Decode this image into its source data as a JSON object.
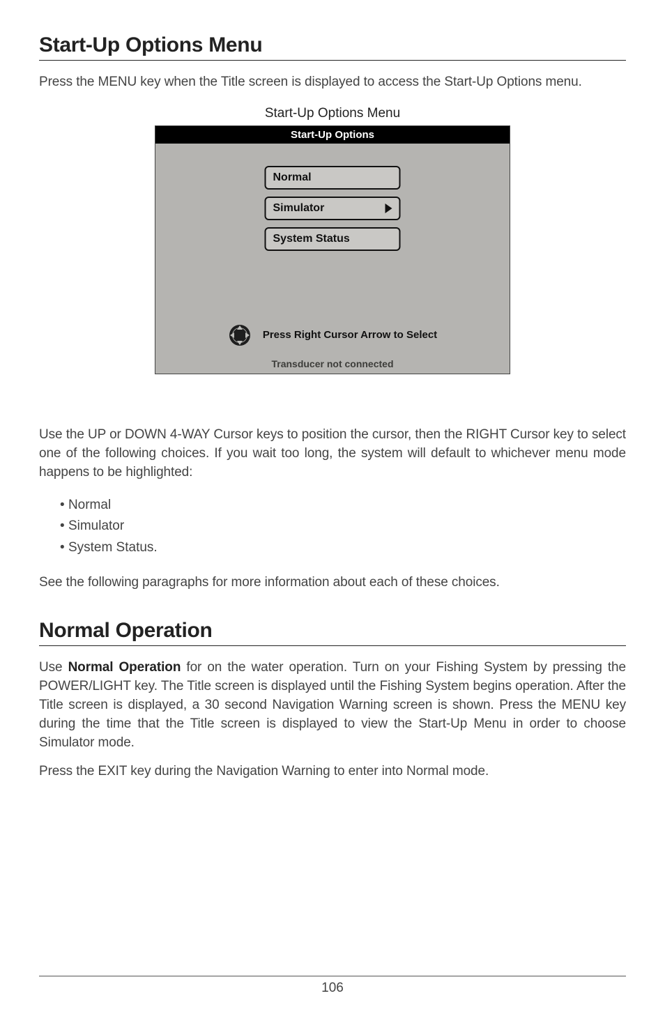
{
  "section1": {
    "title": "Start-Up Options Menu",
    "intro": "Press the MENU key when the Title screen is displayed to access the Start-Up Options menu.",
    "caption": "Start-Up Options Menu"
  },
  "shot": {
    "title": "Start-Up Options",
    "options": {
      "normal": "Normal",
      "simulator": "Simulator",
      "system_status": "System Status"
    },
    "hint": "Press Right Cursor Arrow to Select",
    "footer": "Transducer not connected",
    "cursor_icon": "four-way-cursor-icon"
  },
  "after": {
    "para": "Use the UP or DOWN 4-WAY Cursor keys to position the cursor, then the RIGHT Cursor key to select one of the following choices. If you wait too long, the system will default to whichever menu mode happens to be highlighted:",
    "bullets": {
      "b1": "Normal",
      "b2": "Simulator",
      "b3": "System Status."
    },
    "see": "See the following paragraphs for more information about each of these choices."
  },
  "section2": {
    "title": "Normal Operation",
    "para_lead_bold": "Normal Operation",
    "para_prefix": "Use ",
    "para_rest": " for on the water operation. Turn on your Fishing System by pressing the POWER/LIGHT key. The Title screen is displayed until the Fishing System begins operation. After the Title screen is displayed, a 30 second Navigation Warning screen is shown. Press the MENU key during the time that the Title screen is displayed to view the Start-Up Menu in order to choose Simulator mode.",
    "exit": "Press the EXIT key during the Navigation Warning to enter into Normal mode."
  },
  "page_number": "106"
}
